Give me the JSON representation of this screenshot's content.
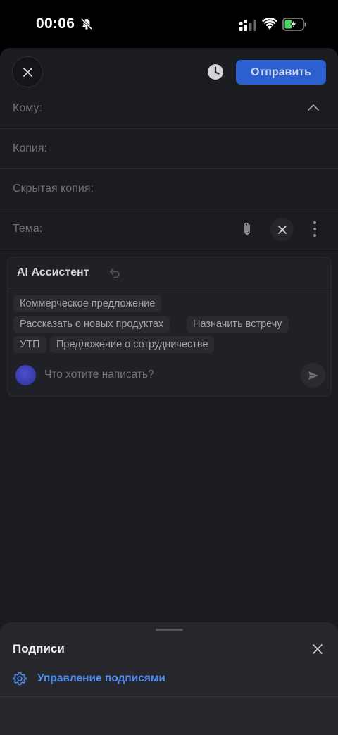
{
  "status_bar": {
    "time": "00:06"
  },
  "compose": {
    "send_label": "Отправить",
    "fields": {
      "to_label": "Кому:",
      "cc_label": "Копия:",
      "bcc_label": "Скрытая копия:",
      "subject_label": "Тема:"
    }
  },
  "ai_assistant": {
    "title": "AI Ассистент",
    "suggestions": [
      "Коммерческое предложение",
      "Рассказать о новых продуктах",
      "Назначить встречу",
      "УТП",
      "Предложение о сотрудничестве"
    ],
    "input_placeholder": "Что хотите написать?"
  },
  "signatures": {
    "title": "Подписи",
    "manage_label": "Управление подписями"
  },
  "colors": {
    "accent": "#2c5fcf",
    "link": "#4d8bf0",
    "background": "#1b1c20"
  }
}
